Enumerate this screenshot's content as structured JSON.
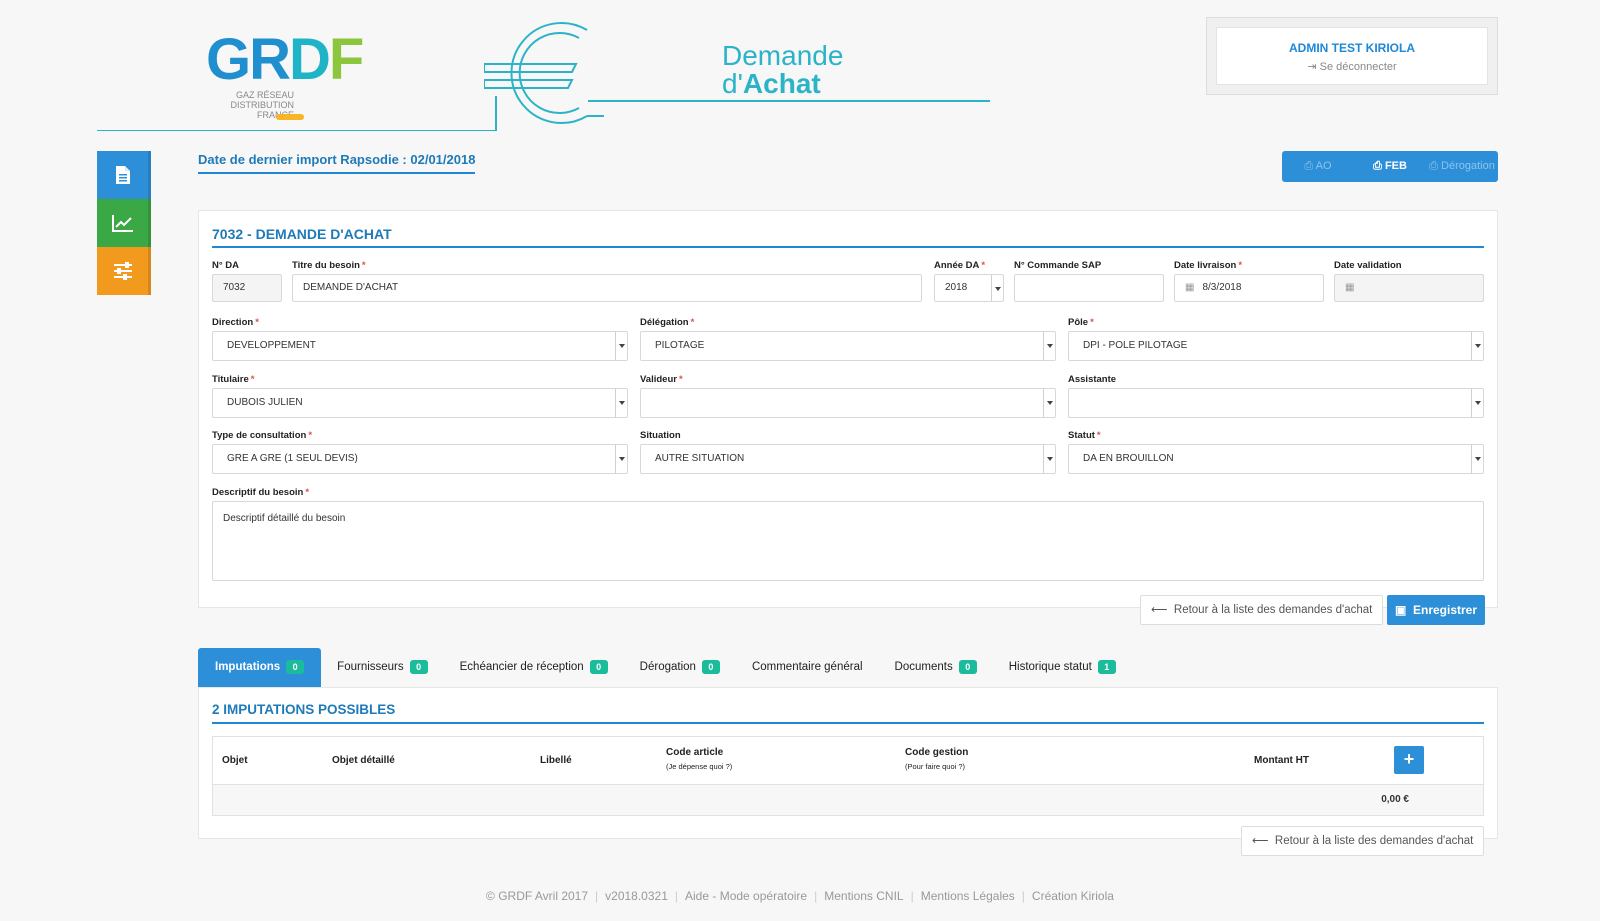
{
  "header": {
    "logo_letters": [
      "G",
      "R",
      "D",
      "F"
    ],
    "logo_sub": "GAZ RÉSEAU DISTRIBUTION FRANCE",
    "title_line1": "Demande",
    "title_line2_prefix": "d'",
    "title_line2_bold": "Achat"
  },
  "user": {
    "name": "ADMIN TEST KIRIOLA",
    "logout": "Se déconnecter"
  },
  "import_date": "Date de dernier import Rapsodie : 02/01/2018",
  "print_buttons": [
    {
      "label": "AO",
      "active": false
    },
    {
      "label": "FEB",
      "active": true
    },
    {
      "label": "Dérogation",
      "active": false
    }
  ],
  "form": {
    "title": "7032 - DEMANDE D'ACHAT",
    "num_da": {
      "label": "N° DA",
      "value": "7032"
    },
    "titre": {
      "label": "Titre du besoin",
      "value": "DEMANDE D'ACHAT"
    },
    "annee": {
      "label": "Année DA",
      "value": "2018"
    },
    "commande": {
      "label": "N° Commande SAP",
      "value": ""
    },
    "livraison": {
      "label": "Date livraison",
      "value": "8/3/2018"
    },
    "validation": {
      "label": "Date validation",
      "value": ""
    },
    "direction": {
      "label": "Direction",
      "value": "DEVELOPPEMENT"
    },
    "delegation": {
      "label": "Délégation",
      "value": "PILOTAGE"
    },
    "pole": {
      "label": "Pôle",
      "value": "DPI - POLE PILOTAGE"
    },
    "titulaire": {
      "label": "Titulaire",
      "value": "DUBOIS JULIEN"
    },
    "valideur": {
      "label": "Valideur",
      "value": ""
    },
    "assistante": {
      "label": "Assistante",
      "value": ""
    },
    "consultation": {
      "label": "Type de consultation",
      "value": "GRE A GRE (1 SEUL DEVIS)"
    },
    "situation": {
      "label": "Situation",
      "value": "AUTRE SITUATION"
    },
    "statut": {
      "label": "Statut",
      "value": "DA EN BROUILLON"
    },
    "descriptif": {
      "label": "Descriptif du besoin",
      "value": "Descriptif détaillé du besoin"
    },
    "back_label": "Retour à la liste des demandes d'achat",
    "save_label": "Enregistrer"
  },
  "tabs": [
    {
      "label": "Imputations",
      "count": "0"
    },
    {
      "label": "Fournisseurs",
      "count": "0"
    },
    {
      "label": "Echéancier de réception",
      "count": "0"
    },
    {
      "label": "Dérogation",
      "count": "0"
    },
    {
      "label": "Commentaire général",
      "count": ""
    },
    {
      "label": "Documents",
      "count": "0"
    },
    {
      "label": "Historique statut",
      "count": "1"
    }
  ],
  "imputations": {
    "title": "2 IMPUTATIONS POSSIBLES",
    "columns": {
      "objet": "Objet",
      "objet_detaille": "Objet détaillé",
      "libelle": "Libellé",
      "code_article": "Code article",
      "code_article_sub": "(Je dépense quoi ?)",
      "code_gestion": "Code gestion",
      "code_gestion_sub": "(Pour faire quoi ?)",
      "montant": "Montant HT"
    },
    "add_label": "+",
    "total": "0,00 €",
    "back_label": "Retour à la liste des demandes d'achat"
  },
  "footer": {
    "items": [
      "© GRDF Avril 2017",
      "v2018.0321",
      "Aide - Mode opératoire",
      "Mentions CNIL",
      "Mentions Légales",
      "Création Kiriola"
    ]
  },
  "colors": {
    "primary": "#2d8fd8",
    "accent": "#2bb3c8",
    "green": "#3aa845",
    "orange": "#f29a1e",
    "badge": "#1bbc9b"
  }
}
